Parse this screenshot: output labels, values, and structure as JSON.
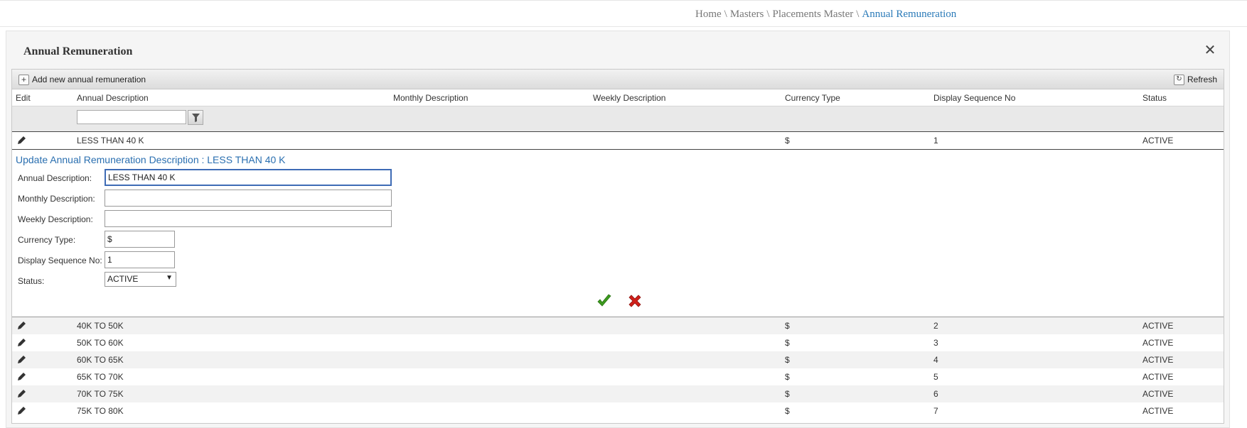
{
  "breadcrumb": {
    "items": [
      "Home",
      "Masters",
      "Placements Master"
    ],
    "current": "Annual Remuneration",
    "separator": "\\"
  },
  "panel": {
    "title": "Annual Remuneration"
  },
  "toolbar": {
    "add_label": "Add new annual remuneration",
    "refresh_label": "Refresh"
  },
  "columns": {
    "edit": "Edit",
    "annual": "Annual Description",
    "monthly": "Monthly Description",
    "weekly": "Weekly Description",
    "currency": "Currency Type",
    "sequence": "Display Sequence No",
    "status": "Status"
  },
  "filter": {
    "value": ""
  },
  "editing_row": {
    "annual": "LESS THAN 40 K",
    "monthly": "",
    "weekly": "",
    "currency": "$",
    "sequence": "1",
    "status": "ACTIVE"
  },
  "edit_form": {
    "title": "Update Annual Remuneration Description : LESS THAN 40 K",
    "labels": {
      "annual": "Annual Description:",
      "monthly": "Monthly Description:",
      "weekly": "Weekly Description:",
      "currency": "Currency Type:",
      "sequence": "Display Sequence No:",
      "status": "Status:"
    },
    "values": {
      "annual": "LESS THAN 40 K",
      "monthly": "",
      "weekly": "",
      "currency": "$",
      "sequence": "1",
      "status": "ACTIVE"
    }
  },
  "rows": [
    {
      "annual": "40K TO 50K",
      "monthly": "",
      "weekly": "",
      "currency": "$",
      "sequence": "2",
      "status": "ACTIVE"
    },
    {
      "annual": "50K TO 60K",
      "monthly": "",
      "weekly": "",
      "currency": "$",
      "sequence": "3",
      "status": "ACTIVE"
    },
    {
      "annual": "60K TO 65K",
      "monthly": "",
      "weekly": "",
      "currency": "$",
      "sequence": "4",
      "status": "ACTIVE"
    },
    {
      "annual": "65K TO 70K",
      "monthly": "",
      "weekly": "",
      "currency": "$",
      "sequence": "5",
      "status": "ACTIVE"
    },
    {
      "annual": "70K TO 75K",
      "monthly": "",
      "weekly": "",
      "currency": "$",
      "sequence": "6",
      "status": "ACTIVE"
    },
    {
      "annual": "75K TO 80K",
      "monthly": "",
      "weekly": "",
      "currency": "$",
      "sequence": "7",
      "status": "ACTIVE"
    }
  ],
  "icons": {
    "edit": "pencil-icon",
    "add": "plus-icon",
    "refresh": "refresh-icon",
    "filter": "filter-icon",
    "close": "close-icon",
    "save": "checkmark-icon",
    "cancel": "cancel-x-icon"
  },
  "colors": {
    "accent": "#2a7ab8",
    "save": "#3c9a1e",
    "cancel": "#d0201a",
    "alt_row": "#f2f2f2"
  }
}
